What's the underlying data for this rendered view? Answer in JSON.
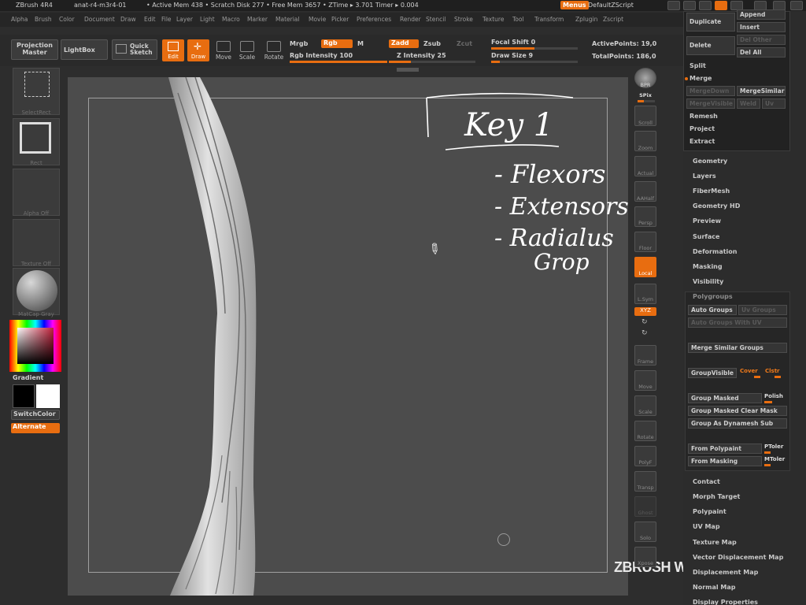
{
  "titlebar": {
    "app": "ZBrush 4R4",
    "doc": "anat-r4-m3r4-01",
    "stats": "• Active Mem 438 • Scratch Disk 277 • Free Mem 3657 • ZTime ▸ 3.701 Timer ▸ 0.004",
    "menus_button": "Menus",
    "script": "DefaultZScript"
  },
  "menubar": [
    "Alpha",
    "Brush",
    "Color",
    "Document",
    "Draw",
    "Edit",
    "File",
    "Layer",
    "Light",
    "Macro",
    "Marker",
    "Material",
    "Movie",
    "Picker",
    "Preferences",
    "Render",
    "Stencil",
    "Stroke",
    "Texture",
    "Tool",
    "Transform",
    "Zplugin",
    "Zscript"
  ],
  "toolbar": {
    "projection_master": "Projection Master",
    "lightbox": "LightBox",
    "quick_sketch": "Quick Sketch",
    "edit": "Edit",
    "draw": "Draw",
    "move": "Move",
    "scale": "Scale",
    "rotate": "Rotate",
    "mrgb": "Mrgb",
    "rgb": "Rgb",
    "m": "M",
    "rgb_intensity": "Rgb Intensity 100",
    "zadd": "Zadd",
    "zsub": "Zsub",
    "zcut": "Zcut",
    "z_intensity": "Z Intensity 25",
    "focal_shift": "Focal Shift 0",
    "draw_size": "Draw Size 9",
    "active_points": "ActivePoints: 19,0",
    "total_points": "TotalPoints: 186,0",
    "rgb_intensity_level": 1.0,
    "z_intensity_level": 0.25,
    "focal_shift_level": 0.5,
    "draw_size_level": 0.1
  },
  "left_shelf": {
    "select_rect": "SelectRect",
    "rect": "Rect",
    "alpha": "Alpha Off",
    "texture": "Texture Off",
    "matcap": "MatCap Gray",
    "gradient": "Gradient",
    "switchcolor": "SwitchColor",
    "alternate": "Alternate"
  },
  "canvas": {
    "note_title": "Key 1",
    "note_items": [
      "- Flexors",
      "- Extensors",
      "- Radialus",
      "Grop"
    ],
    "watermark": "ZBRUSH WORKSHOPS"
  },
  "right_shelf": [
    "BPR",
    "SPix",
    "Scroll",
    "Zoom",
    "Actual",
    "AAHalf",
    "Persp",
    "Floor",
    "Local",
    "L.Sym",
    "XYZ",
    "Frame",
    "Move",
    "Scale",
    "Rotate",
    "PolyF",
    "Transp",
    "Ghost",
    "Solo",
    "Xpose"
  ],
  "palette": {
    "top_buttons": {
      "duplicate": "Duplicate",
      "append": "Append",
      "insert": "Insert",
      "delete": "Delete",
      "del_other": "Del Other",
      "del_all": "Del All",
      "split": "Split",
      "merge": "Merge",
      "merge_down": "MergeDown",
      "merge_similar": "MergeSimilar",
      "merge_visible": "MergeVisible",
      "weld": "Weld",
      "uv": "Uv",
      "remesh": "Remesh",
      "project": "Project",
      "extract": "Extract"
    },
    "sections_top": [
      "Geometry",
      "Layers",
      "FiberMesh",
      "Geometry HD",
      "Preview",
      "Surface",
      "Deformation",
      "Masking",
      "Visibility"
    ],
    "polygroups": {
      "title": "Polygroups",
      "auto_groups": "Auto Groups",
      "uv_groups": "Uv Groups",
      "auto_groups_with_uv": "Auto Groups With UV",
      "merge_similar_groups": "Merge Similar Groups",
      "group_visible": "GroupVisible",
      "coverage": "Cover",
      "clstr": "Clstr",
      "group_masked": "Group Masked",
      "polish": "Polish",
      "group_masked_clear_mask": "Group Masked Clear Mask",
      "group_as_dynamesh_sub": "Group As Dynamesh Sub",
      "from_polypaint": "From Polypaint",
      "ptoler": "PToler",
      "from_masking": "From Masking",
      "mtoler": "MToler"
    },
    "sections_bottom": [
      "Contact",
      "Morph Target",
      "Polypaint",
      "UV Map",
      "Texture Map",
      "Vector Displacement Map",
      "Displacement Map",
      "Normal Map",
      "Display Properties"
    ]
  }
}
